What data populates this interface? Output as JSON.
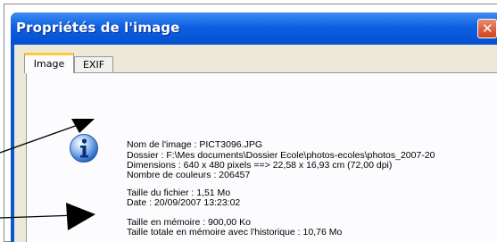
{
  "dialog": {
    "title": "Propriétés de l'image",
    "close_glyph": "✕"
  },
  "tabs": [
    {
      "label": "Image",
      "active": true
    },
    {
      "label": "EXIF",
      "active": false
    }
  ],
  "info_icon": "info-icon",
  "details": {
    "name": "Nom de l'image : PICT3096.JPG",
    "folder": "Dossier : F:\\Mes documents\\Dossier Ecole\\photos-ecoles\\photos_2007-20",
    "dimensions": "Dimensions : 640 x 480 pixels ==> 22,58 x 16,93 cm  (72,00 dpi)",
    "colors": "Nombre de couleurs : 206457",
    "file_size": "Taille du fichier : 1,51 Mo",
    "date": "Date : 20/09/2007 13:23:02",
    "memory": "Taille en mémoire : 900,00 Ko",
    "total_memory": "Taille totale en mémoire avec l'historique : 10,76 Mo"
  },
  "colors": {
    "titlebar": "#0a59d4",
    "dialog_bg": "#ece9d8",
    "active_tab_accent": "#ffc83c",
    "close_button": "#d0421b"
  }
}
